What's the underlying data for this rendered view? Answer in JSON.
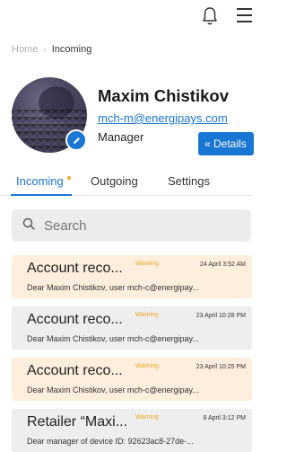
{
  "breadcrumb": {
    "home": "Home",
    "current": "Incoming"
  },
  "profile": {
    "name": "Maxim Chistikov",
    "email": "mch-m@energipays.com",
    "role": "Manager",
    "details_label": "« Details"
  },
  "tabs": [
    {
      "label": "Incoming",
      "active": true,
      "has_unread": true
    },
    {
      "label": "Outgoing",
      "active": false
    },
    {
      "label": "Settings",
      "active": false
    }
  ],
  "search": {
    "placeholder": "Search"
  },
  "messages": [
    {
      "title": "Account reco...",
      "badge": "Warning",
      "time": "24 April 3:52 AM",
      "preview": "Dear Maxim Chistikov, user mch-c@energipay...",
      "highlighted": true
    },
    {
      "title": "Account reco...",
      "badge": "Warning",
      "time": "23 April 10:28 PM",
      "preview": "Dear Maxim Chistikov, user mch-c@energipay...",
      "highlighted": false
    },
    {
      "title": "Account reco...",
      "badge": "Warning",
      "time": "23 April 10:25 PM",
      "preview": "Dear Maxim Chistikov, user mch-c@energipay...",
      "highlighted": true
    },
    {
      "title": "Retailer “Maxi...",
      "badge": "Warning",
      "time": "8 April 3:12 PM",
      "preview": "Dear manager of device ID: 92623ac8-27de-...",
      "highlighted": false
    }
  ],
  "colors": {
    "accent": "#1976d2",
    "warning": "#f5a623",
    "highlight_bg": "#fdeedd",
    "plain_bg": "#eeeeee"
  },
  "icons": {
    "bell": "bell-icon",
    "menu": "menu-icon",
    "search": "search-icon",
    "edit": "pencil-icon"
  }
}
